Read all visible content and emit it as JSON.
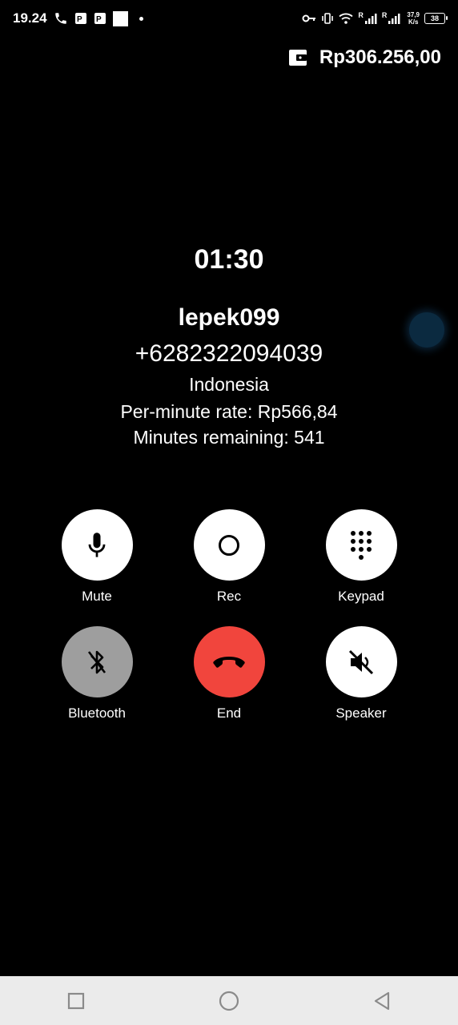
{
  "status_bar": {
    "time": "19.24",
    "battery": "38",
    "net_speed_value": "37,9",
    "net_speed_unit": "K/s",
    "signal_label_1": "R",
    "signal_label_2": "R"
  },
  "balance": {
    "amount": "Rp306.256,00",
    "icon": "wallet-icon"
  },
  "call": {
    "timer": "01:30",
    "name": "lepek099",
    "number": "+6282322094039",
    "country": "Indonesia",
    "rate": "Per-minute rate: Rp566,84",
    "remaining": "Minutes remaining: 541"
  },
  "controls": {
    "mute": "Mute",
    "rec": "Rec",
    "keypad": "Keypad",
    "bluetooth": "Bluetooth",
    "end": "End",
    "speaker": "Speaker"
  },
  "colors": {
    "end_button": "#f1453d",
    "bluetooth_button": "#9e9e9e",
    "navbar_bg": "#ebebeb"
  }
}
